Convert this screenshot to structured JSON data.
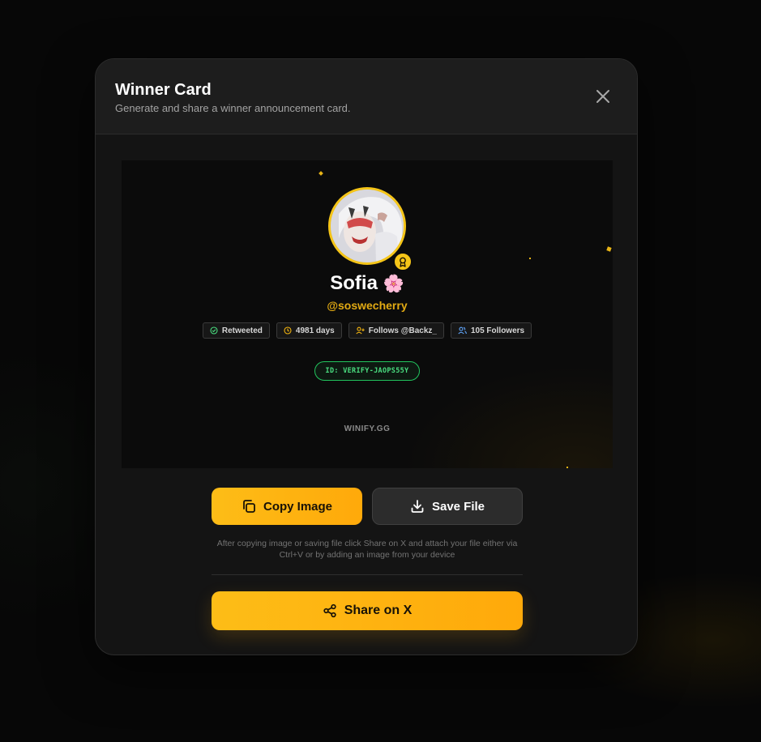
{
  "modal": {
    "title": "Winner Card",
    "subtitle": "Generate and share a winner announcement card."
  },
  "card": {
    "name": "Sofia",
    "name_emoji": "🌸",
    "handle": "@soswecherry",
    "stats": [
      {
        "icon": "check-circle-icon",
        "label": "Retweeted"
      },
      {
        "icon": "clock-icon",
        "label": "4981 days"
      },
      {
        "icon": "user-plus-icon",
        "label": "Follows @Backz_"
      },
      {
        "icon": "users-icon",
        "label": "105 Followers"
      }
    ],
    "verify_id": "ID: VERIFY-JAOPS55Y",
    "watermark": "WINIFY.GG"
  },
  "actions": {
    "copy_label": "Copy Image",
    "save_label": "Save File",
    "hint": "After copying image or saving file click Share on X and attach your file either via Ctrl+V or by adding an image from your device",
    "share_label": "Share on X"
  },
  "colors": {
    "accent": "#fdbd17",
    "verify_green": "#4ade80",
    "handle_gold": "#e2aa13"
  }
}
